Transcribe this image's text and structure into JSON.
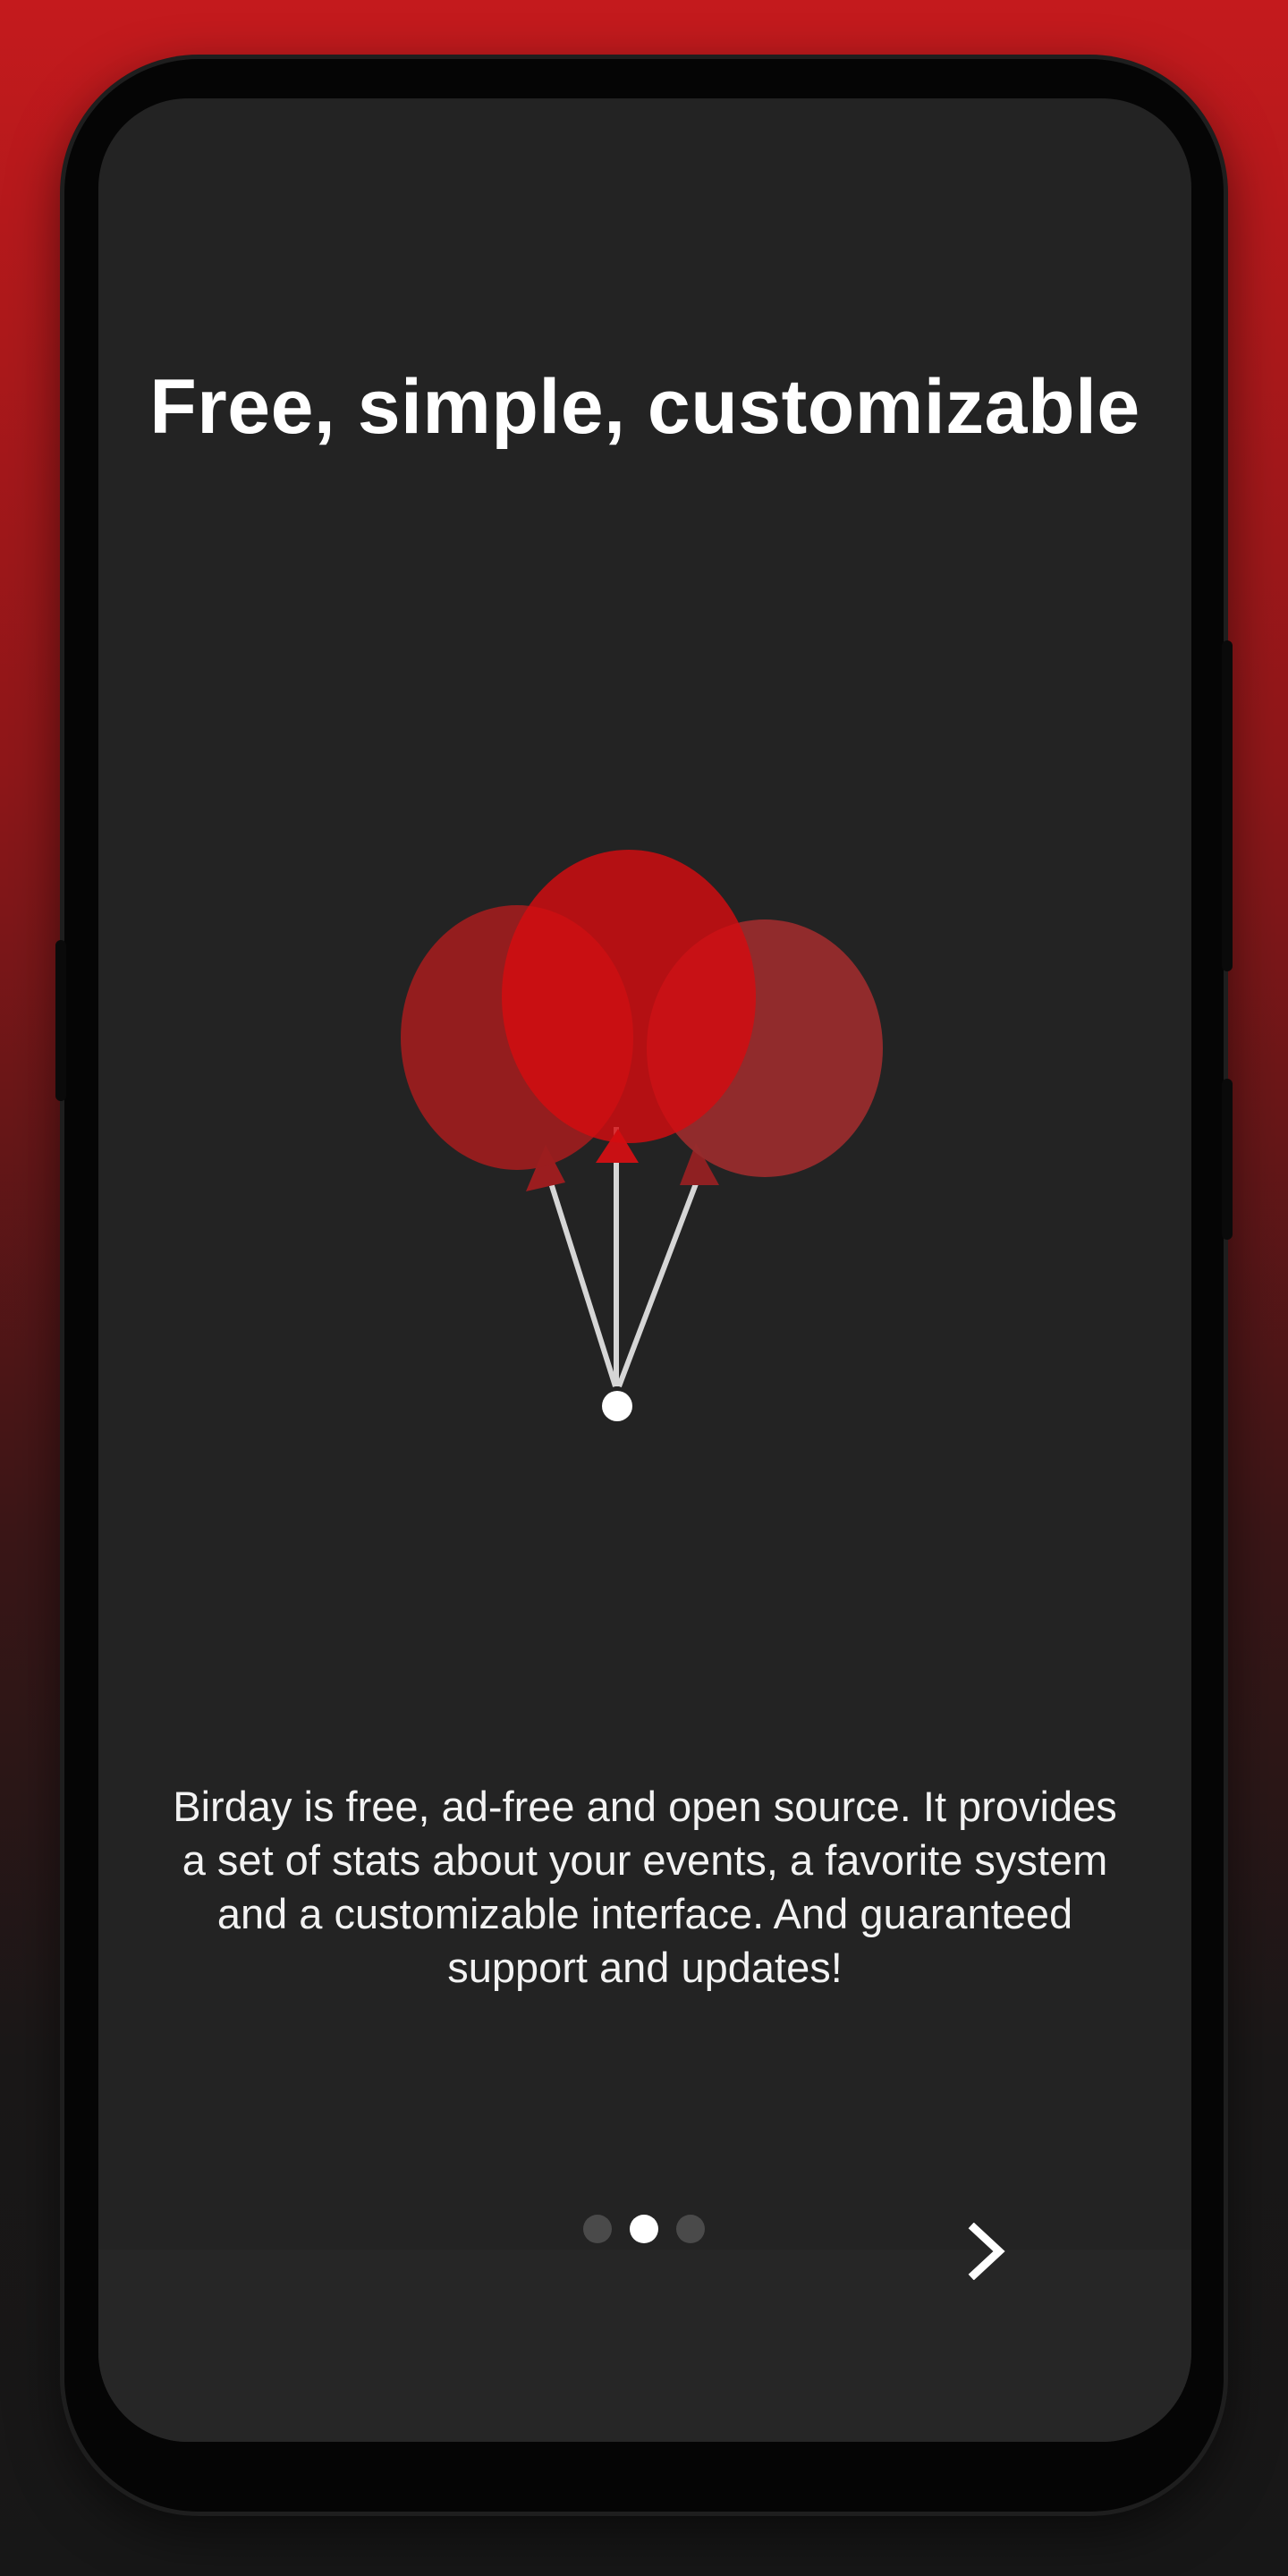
{
  "onboarding": {
    "title": "Free, simple, customizable",
    "description": "Birday is free, ad-free and open source. It provides a set of stats about your events, a favorite system and a customizable interface. And guaranteed support and updates!",
    "page_indicator": {
      "total": 3,
      "current": 2
    },
    "next_icon": "chevron-right-icon",
    "illustration": "balloons-illustration"
  },
  "colors": {
    "background_top": "#c41a1d",
    "screen": "#232323",
    "balloon_left": "#9b1d1f",
    "balloon_center": "#c91014",
    "balloon_right": "#962c2d",
    "accent_white": "#ffffff"
  }
}
